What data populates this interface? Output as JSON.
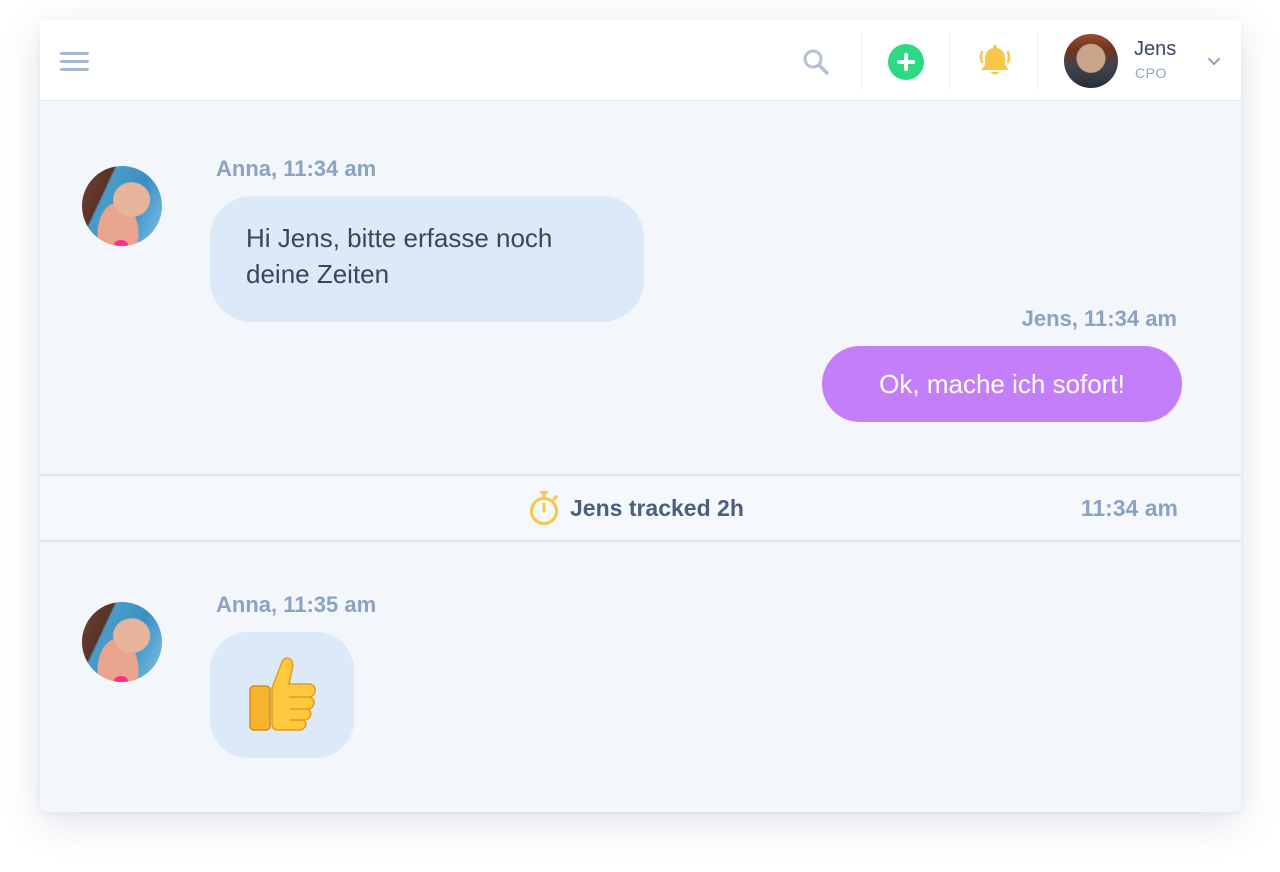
{
  "header": {
    "user_name": "Jens",
    "user_role": "CPO"
  },
  "messages": [
    {
      "meta": "Anna, 11:34 am",
      "line1": "Hi Jens, bitte erfasse noch",
      "line2": "deine Zeiten"
    },
    {
      "meta": "Jens, 11:34 am",
      "text": "Ok, mache ich sofort!"
    },
    {
      "meta": "Anna, 11:35 am",
      "emoji": "thumbs-up"
    }
  ],
  "tracking": {
    "text": "Jens tracked 2h",
    "time": "11:34 am"
  },
  "colors": {
    "accent_green": "#2fd882",
    "bell_yellow": "#f8c649",
    "outgoing_bubble": "#c57efa",
    "incoming_bubble": "#dbe9f8"
  }
}
